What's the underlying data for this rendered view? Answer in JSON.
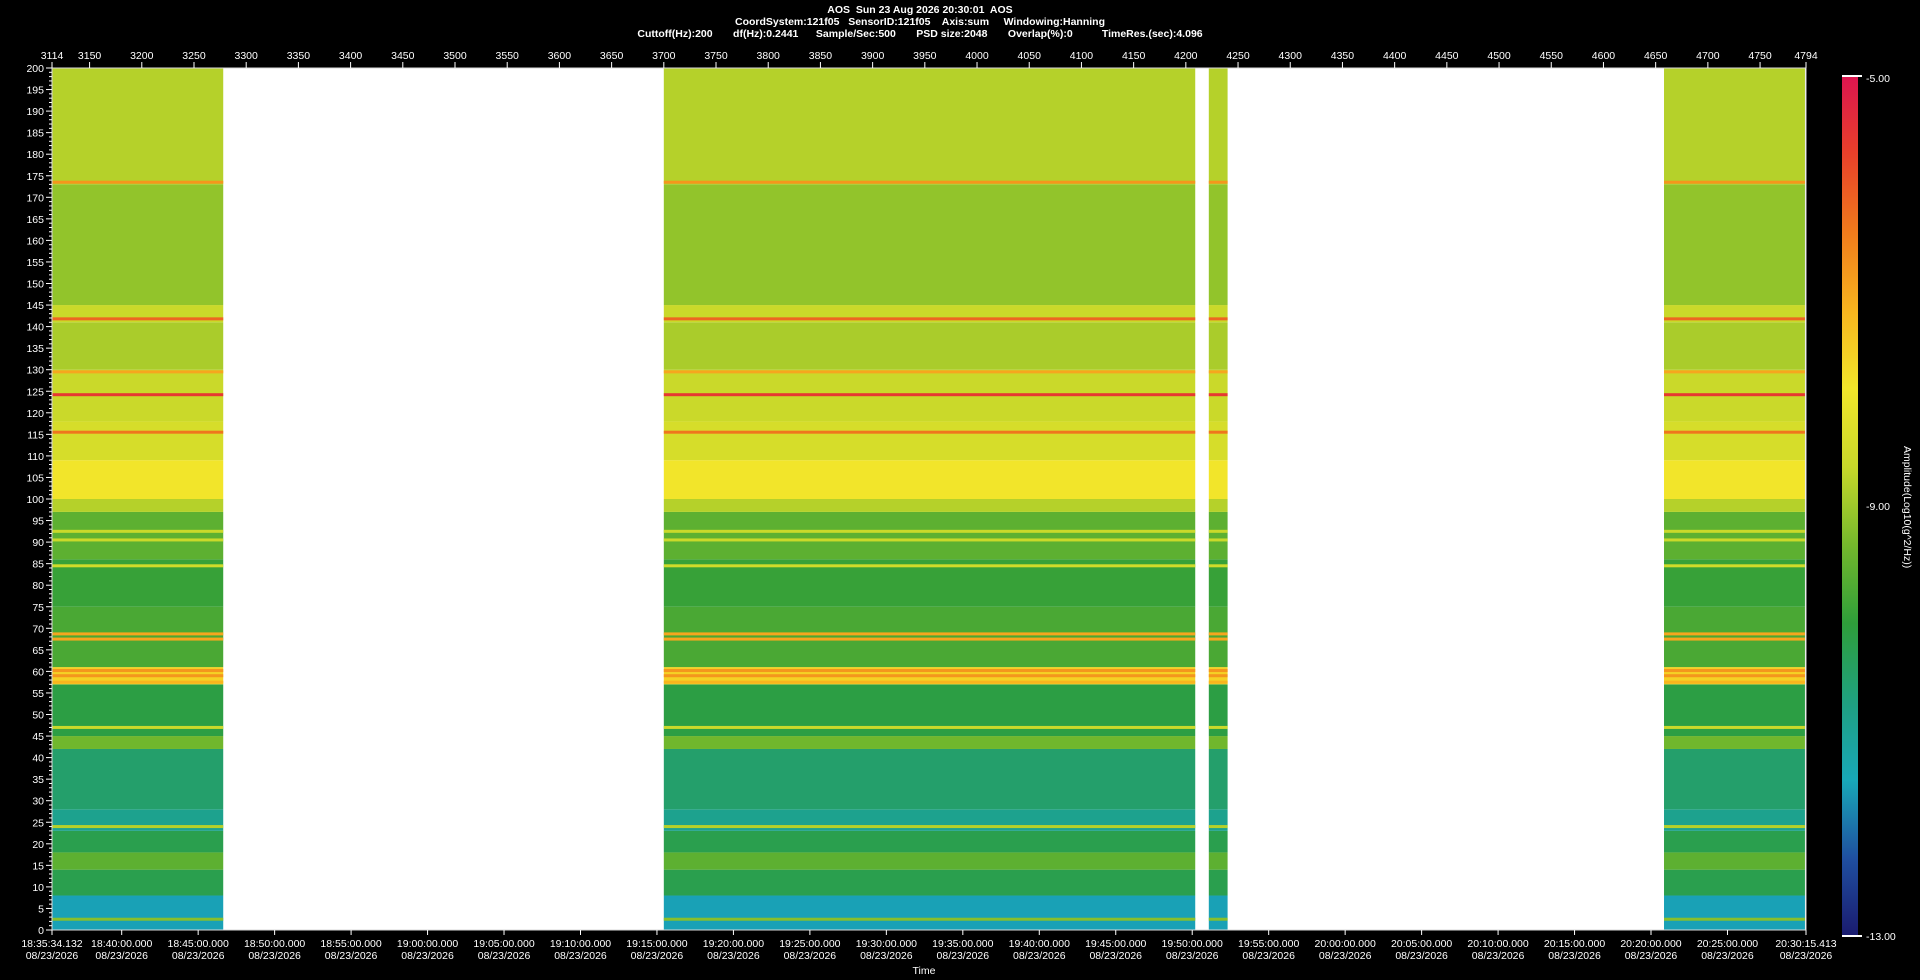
{
  "header": {
    "line1": "AOS  Sun 23 Aug 2026 20:30:01  AOS",
    "line2": "CoordSystem:121f05   SensorID:121f05    Axis:sum     Windowing:Hanning",
    "line3": "Cuttoff(Hz):200       df(Hz):0.2441      Sample/Sec:500       PSD size:2048       Overlap(%):0          TimeRes.(sec):4.096"
  },
  "colorbar": {
    "title": "Amplitude(Log10(g^2/Hz))",
    "max_label": "-5.00",
    "mid_label": "-9.00",
    "min_label": "-13.00",
    "colors": [
      "#1a1a6e",
      "#1f4fa0",
      "#18a8b8",
      "#1fa080",
      "#2e9e3a",
      "#74b82c",
      "#c8d82a",
      "#f2e62a",
      "#f8b41e",
      "#f07a1c",
      "#e8402a",
      "#dc1450"
    ]
  },
  "bottom_axis_title": "Time",
  "chart_data": {
    "type": "heatmap",
    "title": "AOS  Sun 23 Aug 2026 20:30:01  AOS",
    "xlabel": "Time",
    "ylabel": "",
    "zlabel": "Amplitude(Log10(g^2/Hz))",
    "zlim": [
      -13,
      -5
    ],
    "ylim": [
      0,
      200
    ],
    "xlim": [
      3114,
      4794
    ],
    "y_ticks": [
      0,
      5,
      10,
      15,
      20,
      25,
      30,
      35,
      40,
      45,
      50,
      55,
      60,
      65,
      70,
      75,
      80,
      85,
      90,
      95,
      100,
      105,
      110,
      115,
      120,
      125,
      130,
      135,
      140,
      145,
      150,
      155,
      160,
      165,
      170,
      175,
      180,
      185,
      190,
      195,
      200
    ],
    "top_ticks": [
      3114,
      3150,
      3200,
      3250,
      3300,
      3350,
      3400,
      3450,
      3500,
      3550,
      3600,
      3650,
      3700,
      3750,
      3800,
      3850,
      3900,
      3950,
      4000,
      4050,
      4100,
      4150,
      4200,
      4250,
      4300,
      4350,
      4400,
      4450,
      4500,
      4550,
      4600,
      4650,
      4700,
      4750,
      4794
    ],
    "time_ticks": [
      {
        "x": 3114,
        "time": "18:35:34.132",
        "date": "08/23/2026"
      },
      {
        "x": 3180.75,
        "time": "18:40:00.000",
        "date": "08/23/2026"
      },
      {
        "x": 3253.99,
        "time": "18:45:00.000",
        "date": "08/23/2026"
      },
      {
        "x": 3327.23,
        "time": "18:50:00.000",
        "date": "08/23/2026"
      },
      {
        "x": 3400.47,
        "time": "18:55:00.000",
        "date": "08/23/2026"
      },
      {
        "x": 3473.71,
        "time": "19:00:00.000",
        "date": "08/23/2026"
      },
      {
        "x": 3546.95,
        "time": "19:05:00.000",
        "date": "08/23/2026"
      },
      {
        "x": 3620.19,
        "time": "19:10:00.000",
        "date": "08/23/2026"
      },
      {
        "x": 3693.43,
        "time": "19:15:00.000",
        "date": "08/23/2026"
      },
      {
        "x": 3766.67,
        "time": "19:20:00.000",
        "date": "08/23/2026"
      },
      {
        "x": 3839.91,
        "time": "19:25:00.000",
        "date": "08/23/2026"
      },
      {
        "x": 3913.15,
        "time": "19:30:00.000",
        "date": "08/23/2026"
      },
      {
        "x": 3986.39,
        "time": "19:35:00.000",
        "date": "08/23/2026"
      },
      {
        "x": 4059.63,
        "time": "19:40:00.000",
        "date": "08/23/2026"
      },
      {
        "x": 4132.87,
        "time": "19:45:00.000",
        "date": "08/23/2026"
      },
      {
        "x": 4206.11,
        "time": "19:50:00.000",
        "date": "08/23/2026"
      },
      {
        "x": 4279.35,
        "time": "19:55:00.000",
        "date": "08/23/2026"
      },
      {
        "x": 4352.59,
        "time": "20:00:00.000",
        "date": "08/23/2026"
      },
      {
        "x": 4425.83,
        "time": "20:05:00.000",
        "date": "08/23/2026"
      },
      {
        "x": 4499.07,
        "time": "20:10:00.000",
        "date": "08/23/2026"
      },
      {
        "x": 4572.31,
        "time": "20:15:00.000",
        "date": "08/23/2026"
      },
      {
        "x": 4645.55,
        "time": "20:20:00.000",
        "date": "08/23/2026"
      },
      {
        "x": 4718.79,
        "time": "20:25:00.000",
        "date": "08/23/2026"
      },
      {
        "x": 4794,
        "time": "20:30:15.413",
        "date": "08/23/2026"
      }
    ],
    "data_segments": [
      [
        3114,
        3278
      ],
      [
        3700,
        4209
      ],
      [
        4222,
        4240
      ],
      [
        4658,
        4793
      ]
    ],
    "frequency_profile": [
      {
        "from": 0,
        "to": 8,
        "level": -11.6
      },
      {
        "from": 8,
        "to": 14,
        "level": -10.3
      },
      {
        "from": 14,
        "to": 18,
        "level": -9.6
      },
      {
        "from": 18,
        "to": 23,
        "level": -10.3
      },
      {
        "from": 23,
        "to": 28,
        "level": -11.0
      },
      {
        "from": 28,
        "to": 42,
        "level": -10.6
      },
      {
        "from": 42,
        "to": 45,
        "level": -9.4
      },
      {
        "from": 45,
        "to": 57,
        "level": -10.2
      },
      {
        "from": 57,
        "to": 61,
        "level": -7.6
      },
      {
        "from": 61,
        "to": 75,
        "level": -9.8
      },
      {
        "from": 75,
        "to": 86,
        "level": -10.0
      },
      {
        "from": 86,
        "to": 97,
        "level": -9.6
      },
      {
        "from": 97,
        "to": 100,
        "level": -8.8
      },
      {
        "from": 100,
        "to": 109,
        "level": -7.9
      },
      {
        "from": 109,
        "to": 118,
        "level": -8.4
      },
      {
        "from": 118,
        "to": 130,
        "level": -8.6
      },
      {
        "from": 130,
        "to": 141,
        "level": -8.9
      },
      {
        "from": 141,
        "to": 145,
        "level": -8.6
      },
      {
        "from": 145,
        "to": 173,
        "level": -9.1
      },
      {
        "from": 173,
        "to": 200,
        "level": -8.8
      }
    ],
    "tonal_lines": [
      {
        "freq": 2.5,
        "level": -9.2
      },
      {
        "freq": 24,
        "level": -8.8
      },
      {
        "freq": 47,
        "level": -8.6
      },
      {
        "freq": 57.5,
        "level": -7.2
      },
      {
        "freq": 59,
        "level": -6.8
      },
      {
        "freq": 60.2,
        "level": -6.8
      },
      {
        "freq": 67.5,
        "level": -7.0
      },
      {
        "freq": 68.7,
        "level": -7.0
      },
      {
        "freq": 84.5,
        "level": -8.5
      },
      {
        "freq": 90.5,
        "level": -8.6
      },
      {
        "freq": 92.5,
        "level": -8.6
      },
      {
        "freq": 115.5,
        "level": -6.4
      },
      {
        "freq": 124.2,
        "level": -5.6
      },
      {
        "freq": 129.5,
        "level": -7.0
      },
      {
        "freq": 141.8,
        "level": -6.2
      },
      {
        "freq": 173.5,
        "level": -6.8
      }
    ]
  }
}
